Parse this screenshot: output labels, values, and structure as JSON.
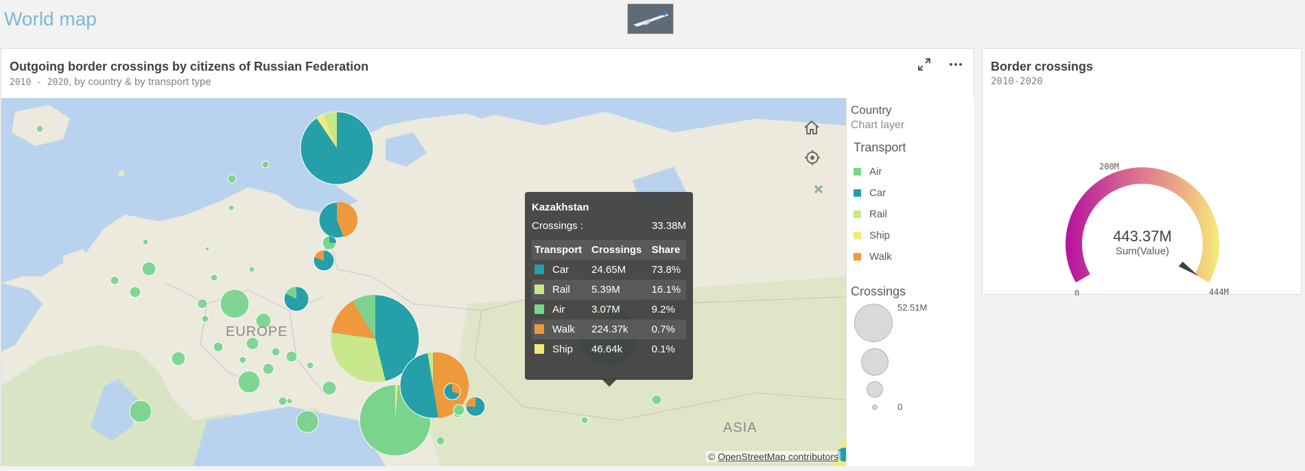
{
  "sheet": {
    "title": "World map"
  },
  "map_panel": {
    "title": "Outgoing border crossings by citizens of Russian Federation",
    "subtitle_years": "2010 - 2020",
    "subtitle_rest": ", by country & by transport type",
    "attribution_prefix": "©",
    "attribution_link": "OpenStreetMap contributors",
    "labels": {
      "europe": "EUROPE",
      "asia": "ASIA"
    },
    "icons": {
      "expand": "expand-icon",
      "more": "more-icon",
      "home": "home-icon",
      "locate": "locate-icon",
      "close": "close-icon"
    }
  },
  "legend": {
    "country_heading": "Country",
    "chart_layer": "Chart layer",
    "transport_heading": "Transport",
    "transport_items": [
      {
        "label": "Air",
        "color": "#7bd48e"
      },
      {
        "label": "Car",
        "color": "#25a0a8"
      },
      {
        "label": "Rail",
        "color": "#c8e88b"
      },
      {
        "label": "Ship",
        "color": "#f4e97d"
      },
      {
        "label": "Walk",
        "color": "#ee9a3c"
      }
    ],
    "size_heading": "Crossings",
    "size_max": "52.51M",
    "size_min": "0"
  },
  "tooltip": {
    "country": "Kazakhstan",
    "crossings_label": "Crossings :",
    "crossings_value": "33.38M",
    "columns": [
      "Transport",
      "Crossings",
      "Share"
    ],
    "rows": [
      {
        "transport": "Car",
        "crossings": "24.65M",
        "share": "73.8%",
        "color": "#25a0a8"
      },
      {
        "transport": "Rail",
        "crossings": "5.39M",
        "share": "16.1%",
        "color": "#c8e88b"
      },
      {
        "transport": "Air",
        "crossings": "3.07M",
        "share": "9.2%",
        "color": "#7bd48e"
      },
      {
        "transport": "Walk",
        "crossings": "224.37k",
        "share": "0.7%",
        "color": "#ee9a3c"
      },
      {
        "transport": "Ship",
        "crossings": "46.64k",
        "share": "0.1%",
        "color": "#f4e97d"
      }
    ]
  },
  "gauge_panel": {
    "title": "Border crossings",
    "subtitle": "2010-2020",
    "value_text": "443.37M",
    "measure_label": "Sum(Value)",
    "tick_min": "0",
    "tick_mid": "200M",
    "tick_max": "444M",
    "value": 443.37,
    "max": 444
  }
}
